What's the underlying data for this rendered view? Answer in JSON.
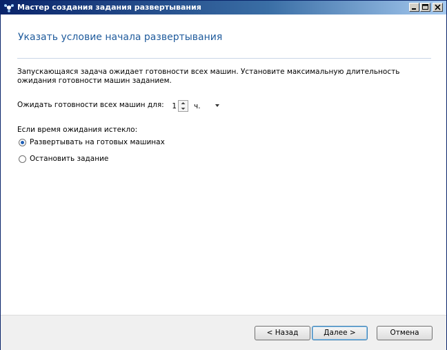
{
  "window": {
    "title": "Мастер создания задания развертывания"
  },
  "page": {
    "title": "Указать условие начала развертывания",
    "description": "Запускающаяся задача ожидает готовности всех машин. Установите максимальную длительность ожидания готовности машин заданием."
  },
  "wait": {
    "label": "Ожидать готовности всех машин для:",
    "value": "1",
    "unit": "ч."
  },
  "timeout": {
    "label": "Если время ожидания истекло:",
    "options": [
      {
        "label": "Развертывать на готовых машинах",
        "checked": true
      },
      {
        "label": "Остановить задание",
        "checked": false
      }
    ]
  },
  "buttons": {
    "back": "< Назад",
    "next": "Далее >",
    "cancel": "Отмена"
  },
  "colors": {
    "accent": "#1f5b9c",
    "title_bar": "#0a246a"
  }
}
